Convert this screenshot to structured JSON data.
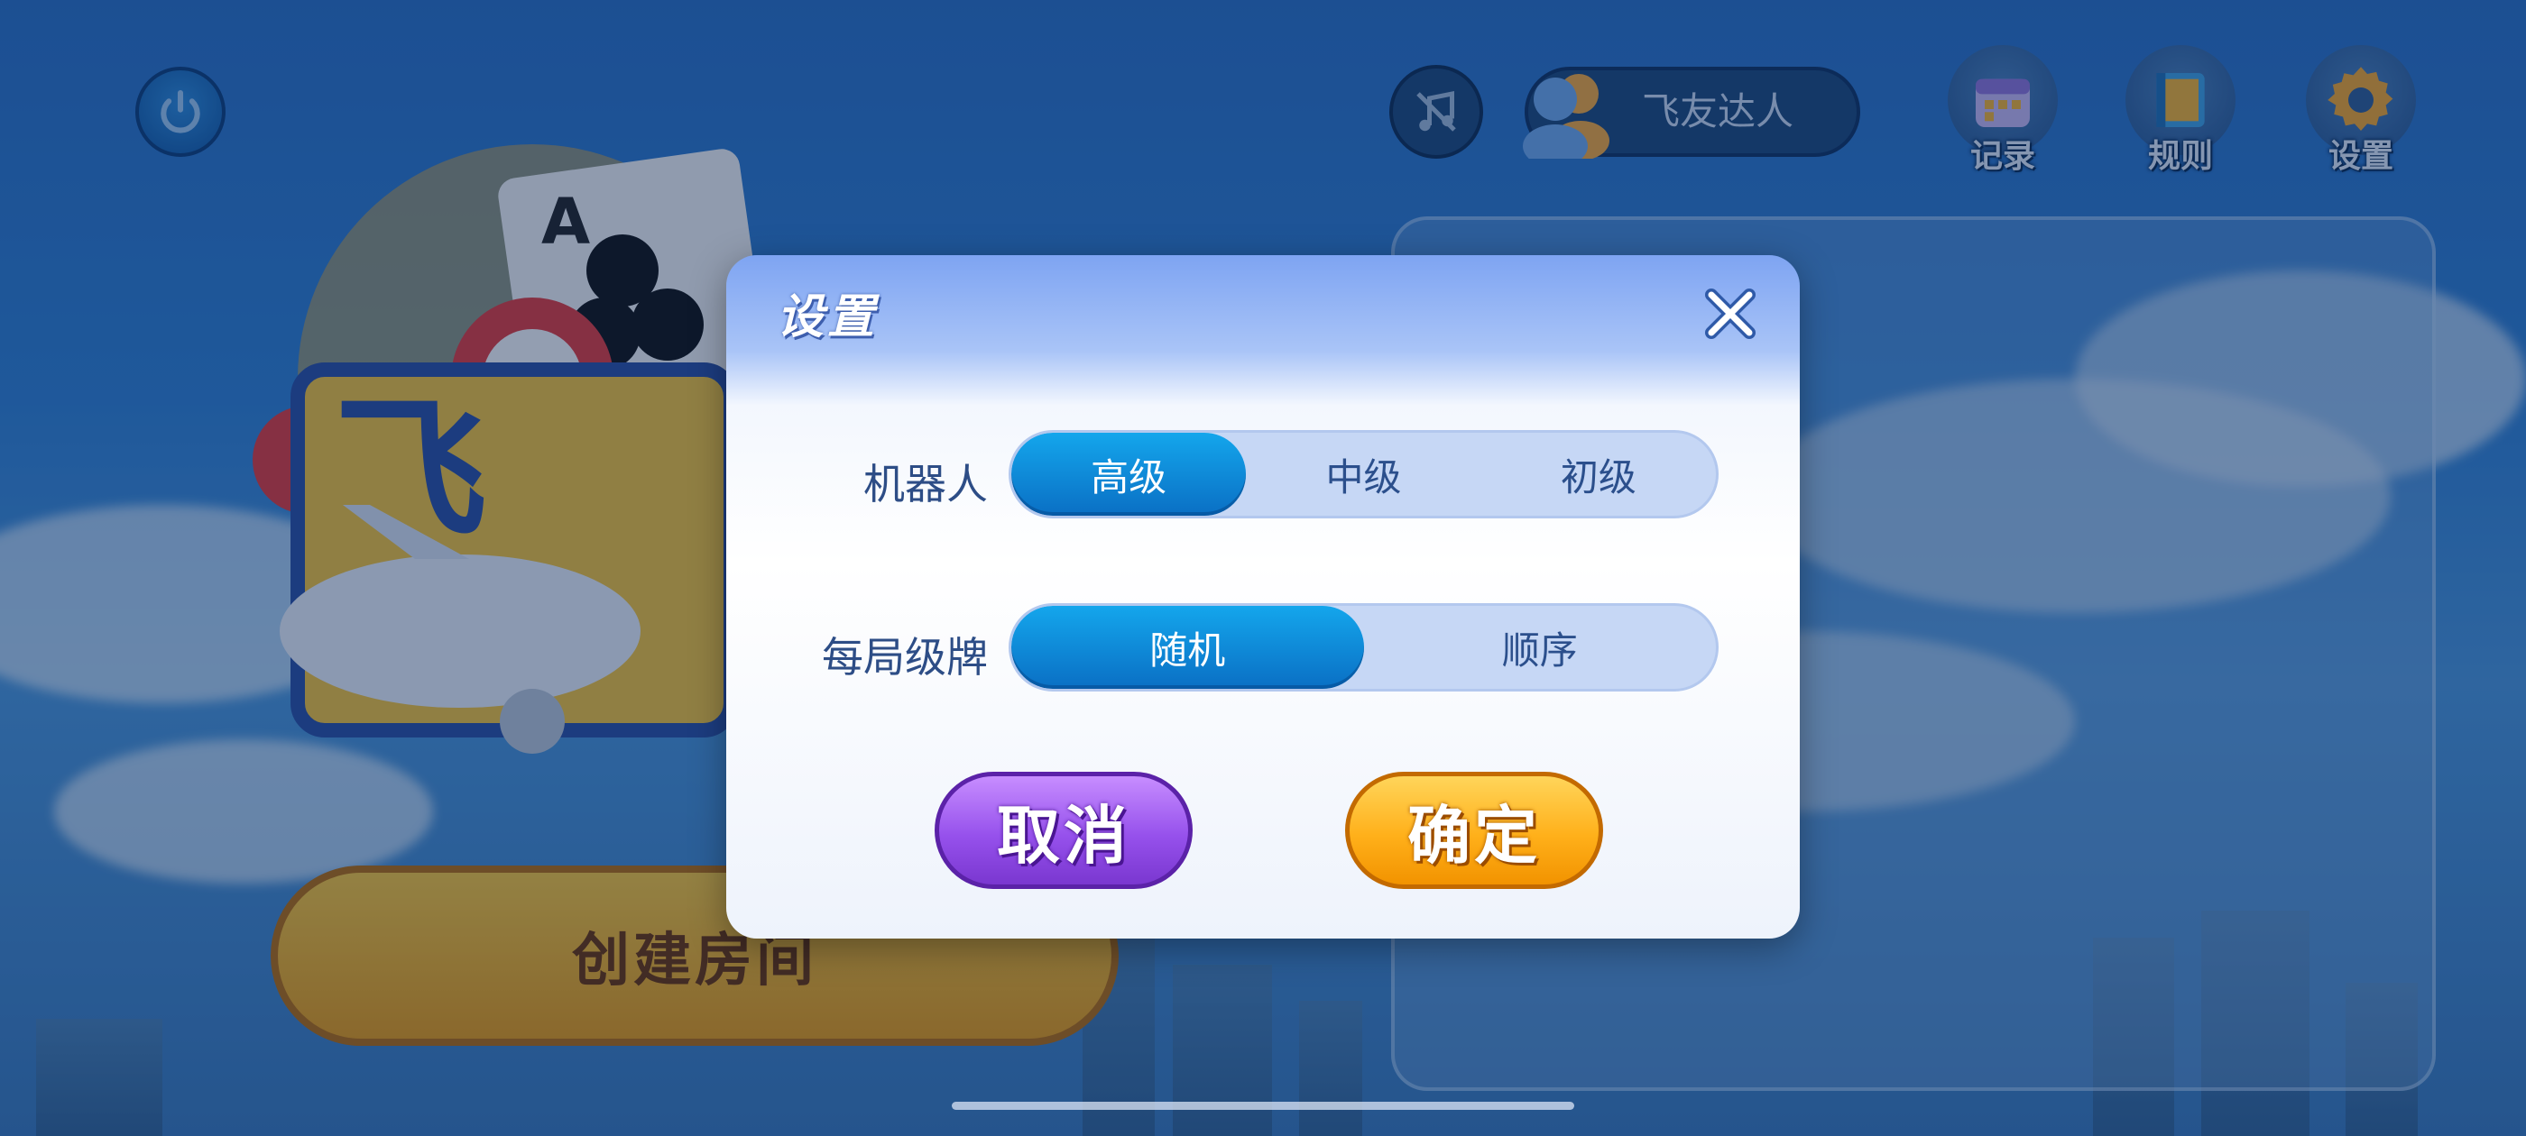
{
  "header": {
    "user_name": "飞友达人",
    "records_label": "记录",
    "rules_label": "规则",
    "settings_label": "设置",
    "icons": {
      "power": "power-icon",
      "music": "music-off-icon",
      "avatar": "user-avatar-icon",
      "records": "calendar-icon",
      "rules": "book-icon",
      "settings": "gear-icon"
    }
  },
  "lobby": {
    "create_room_label": "创建房间"
  },
  "dialog": {
    "title": "设置",
    "robot_label": "机器人",
    "robot_options": [
      "高级",
      "中级",
      "初级"
    ],
    "robot_selected": "高级",
    "level_label": "每局级牌",
    "level_options": [
      "随机",
      "顺序"
    ],
    "level_selected": "随机",
    "cancel_label": "取消",
    "confirm_label": "确定"
  },
  "colors": {
    "accent_blue": "#0a8fd8",
    "cancel_purple": "#9651ec",
    "confirm_orange": "#ffb01a",
    "label_text": "#2d4d86"
  }
}
